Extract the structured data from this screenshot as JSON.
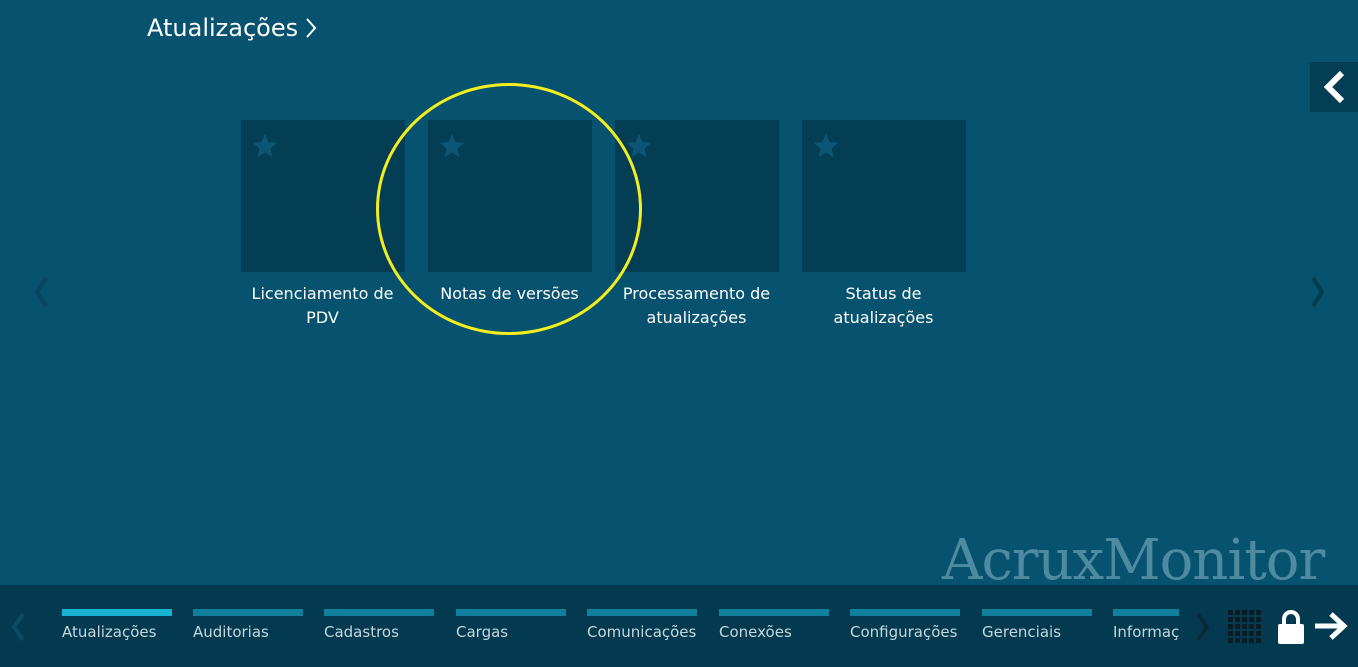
{
  "header": {
    "breadcrumb": "Atualizações"
  },
  "tiles": [
    {
      "label": "Licenciamento de PDV",
      "favorite": false
    },
    {
      "label": "Notas de versões",
      "favorite": false,
      "highlighted": true
    },
    {
      "label": "Processamento de atualizações",
      "favorite": false
    },
    {
      "label": "Status de atualizações",
      "favorite": false
    }
  ],
  "watermark": "AcruxMonitor",
  "bottom_bar": {
    "active_tab": "Atualizações",
    "tabs": [
      {
        "label": "Atualizações"
      },
      {
        "label": "Auditorias"
      },
      {
        "label": "Cadastros"
      },
      {
        "label": "Cargas"
      },
      {
        "label": "Comunicações"
      },
      {
        "label": "Conexões"
      },
      {
        "label": "Configurações"
      },
      {
        "label": "Gerenciais"
      },
      {
        "label": "Informações"
      }
    ]
  },
  "colors": {
    "background": "#07526f",
    "tile": "#033e55",
    "highlight": "#f4ee1f",
    "tab_bar": "#11809c",
    "tab_bar_active": "#17b1d2"
  },
  "icons": [
    "chevron-right-icon",
    "chevron-left-icon",
    "star-icon",
    "grid-icon",
    "lock-icon",
    "arrow-right-icon"
  ]
}
